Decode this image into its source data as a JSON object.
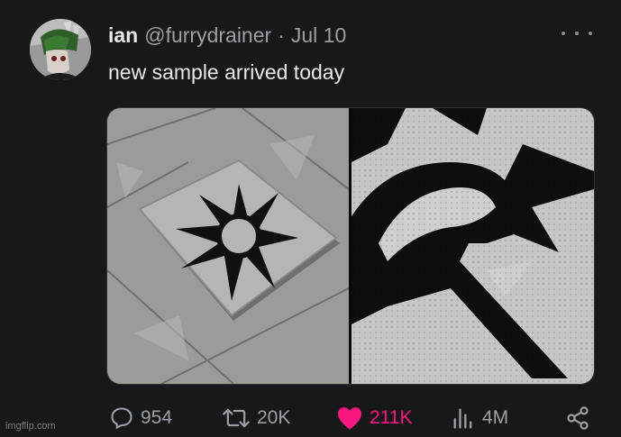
{
  "tweet": {
    "name": "ian",
    "handle": "@furrydrainer",
    "separator": "·",
    "date": "Jul 10",
    "text": "new sample arrived today"
  },
  "media": {
    "description_left": "photo of grey rug with black spiky sun design on stone floor",
    "description_right": "close-up of rug tufting"
  },
  "actions": {
    "replies": "954",
    "reposts": "20K",
    "likes": "211K",
    "views": "4M"
  },
  "colors": {
    "background": "#16181a",
    "like": "#f91880",
    "muted": "#9aa0a6"
  },
  "icons": [
    "more-icon",
    "reply-icon",
    "repost-icon",
    "like-icon",
    "views-icon",
    "share-icon"
  ],
  "watermark": "imgflip.com"
}
